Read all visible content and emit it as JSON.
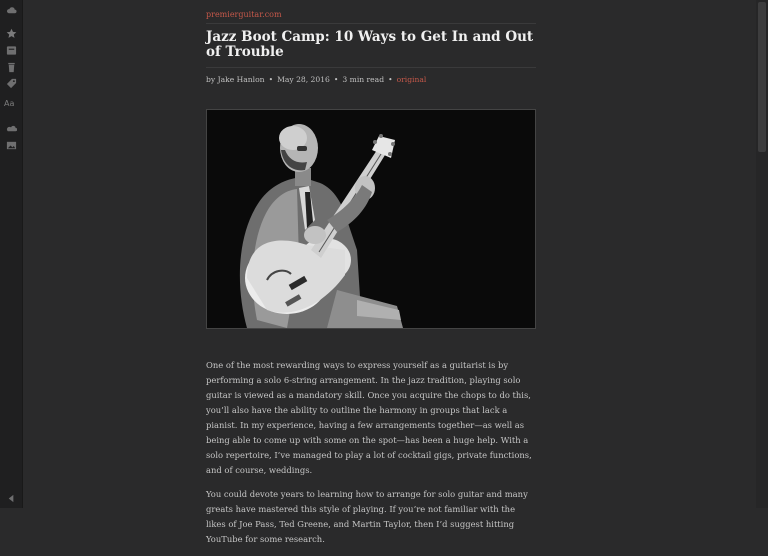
{
  "sidebar": {
    "icons": [
      "cloud-icon",
      "star-icon",
      "archive-icon",
      "trash-icon",
      "tag-icon",
      "text-size-icon",
      "share-icon",
      "image-icon",
      "collapse-arrow-icon"
    ],
    "text_size_label": "Aa"
  },
  "article": {
    "source": "premierguitar.com",
    "title": "Jazz Boot Camp: 10 Ways to Get In and Out of Trouble",
    "byline": "by Jake Hanlon",
    "date": "May 28, 2016",
    "read_time": "3 min read",
    "original_link": "original",
    "paragraphs": [
      "One of the most rewarding ways to express yourself as a guitarist is by performing a solo 6-string arrangement. In the jazz tradition, playing solo guitar is viewed as a mandatory skill. Once you acquire the chops to do this, you’ll also have the ability to outline the harmony in groups that lack a pianist. In my experience, having a few arrangements together—as well as being able to come up with some on the spot—has been a huge help. With a solo repertoire, I’ve managed to play a lot of cocktail gigs, private functions, and of course, weddings.",
      "You could devote years to learning how to arrange for solo guitar and many greats have mastered this style of playing. If you’re not familiar with the likes of Joe Pass, Ted Greene, and Martin Taylor, then I’d suggest hitting YouTube for some research."
    ]
  },
  "colors": {
    "background": "#2a2a2b",
    "sidebar": "#1f1f20",
    "accent": "#c5584a",
    "title": "#f0f0f0"
  }
}
